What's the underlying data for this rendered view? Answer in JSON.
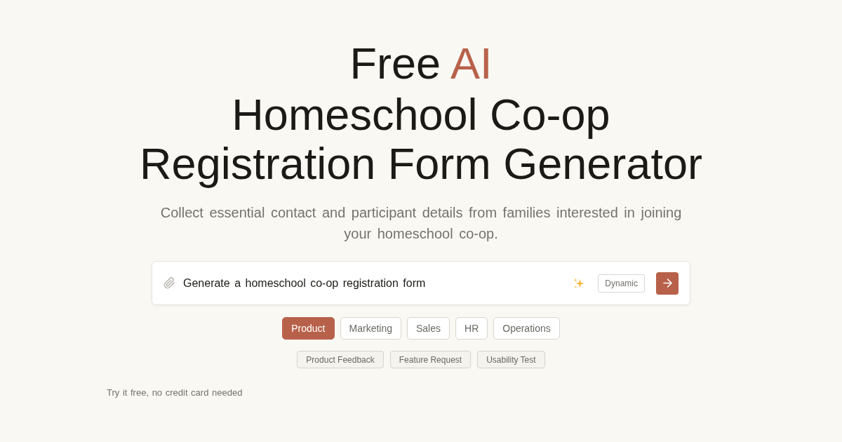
{
  "title": {
    "lead": "Free",
    "highlight": "AI",
    "lines": [
      "Homeschool Co-op",
      "Registration Form Generator"
    ]
  },
  "subtitle": "Collect essential contact and participant details from families interested in joining your homeschool co-op.",
  "prompt": {
    "value": "Generate a homeschool co-op registration form",
    "mode": "Dynamic"
  },
  "categories": [
    {
      "label": "Product",
      "selected": true
    },
    {
      "label": "Marketing",
      "selected": false
    },
    {
      "label": "Sales",
      "selected": false
    },
    {
      "label": "HR",
      "selected": false
    },
    {
      "label": "Operations",
      "selected": false
    }
  ],
  "templates": [
    "Product Feedback",
    "Feature Request",
    "Usability Test"
  ],
  "footnote": "Try it free, no credit card needed"
}
